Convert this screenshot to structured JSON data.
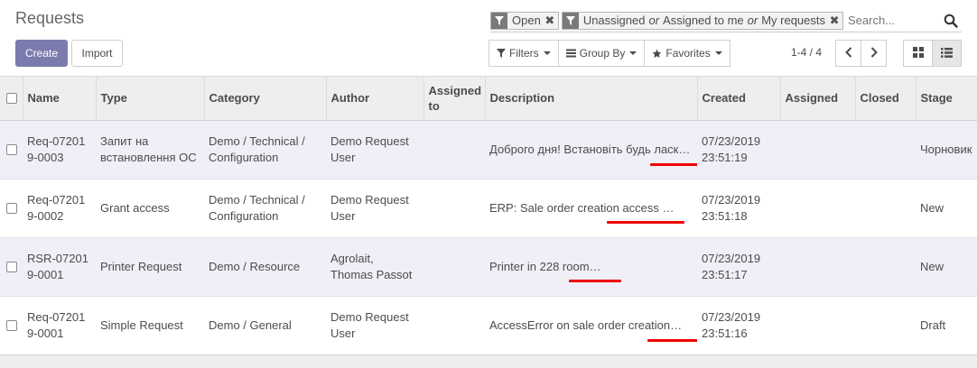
{
  "page_title": "Requests",
  "buttons": {
    "create": "Create",
    "import": "Import"
  },
  "search": {
    "facets": [
      {
        "values": [
          "Open"
        ]
      },
      {
        "values": [
          "Unassigned",
          "Assigned to me",
          "My requests"
        ],
        "separator": "or"
      }
    ],
    "placeholder": "Search..."
  },
  "toolbar": {
    "filters": "Filters",
    "group_by": "Group By",
    "favorites": "Favorites"
  },
  "pager": {
    "value": "1-4 / 4"
  },
  "table": {
    "columns": [
      "Name",
      "Type",
      "Category",
      "Author",
      "Assigned to",
      "Description",
      "Created",
      "Assigned",
      "Closed",
      "Stage"
    ],
    "rows": [
      {
        "name": "Req-072019-0003",
        "type": "Запит на встановлення ОС",
        "category": "Demo / Technical / Configuration",
        "author": "Demo Request User",
        "assigned_to": "",
        "description": "Доброго дня! Встановіть будь ласк…",
        "created": "07/23/2019 23:51:19",
        "assigned": "",
        "closed": "",
        "stage": "Чорновик"
      },
      {
        "name": "Req-072019-0002",
        "type": "Grant access",
        "category": "Demo / Technical / Configuration",
        "author": "Demo Request User",
        "assigned_to": "",
        "description": "ERP: Sale order creation access …",
        "created": "07/23/2019 23:51:18",
        "assigned": "",
        "closed": "",
        "stage": "New"
      },
      {
        "name": "RSR-072019-0001",
        "type": "Printer Request",
        "category": "Demo / Resource",
        "author": "Agrolait, Thomas Passot",
        "assigned_to": "",
        "description": "Printer in 228 room…",
        "created": "07/23/2019 23:51:17",
        "assigned": "",
        "closed": "",
        "stage": "New"
      },
      {
        "name": "Req-072019-0001",
        "type": "Simple Request",
        "category": "Demo / General",
        "author": "Demo Request User",
        "assigned_to": "",
        "description": "AccessError on sale order creation…",
        "created": "07/23/2019 23:51:16",
        "assigned": "",
        "closed": "",
        "stage": "Draft"
      }
    ]
  },
  "colors": {
    "primary": "#7c7bad",
    "row_highlight": "#f0eff7",
    "annotation": "#ee0000"
  }
}
